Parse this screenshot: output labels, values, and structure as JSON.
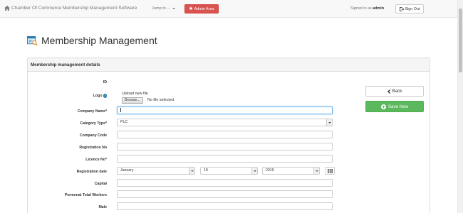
{
  "navbar": {
    "brand": "Chamber Of Commerce Membership Management Software",
    "jump_label": "Jump to ...",
    "admin_label": "Admin Area",
    "signed_prefix": "Signed in as ",
    "signed_user": "admin",
    "signout_label": "Sign Out"
  },
  "page": {
    "title": "Membership Management"
  },
  "panel": {
    "heading": "Membership management details"
  },
  "form": {
    "id_label": "ID",
    "logo_label": "Logo",
    "upload_label": "Upload new file",
    "browse_label": "Browse...",
    "no_file": "No file selected.",
    "company_name_label": "Company Name*",
    "company_name_value": "",
    "category_type_label": "Category Type*",
    "category_type_value": "PLC",
    "company_code_label": "Company Code",
    "registration_no_label": "Registration No",
    "licence_no_label": "Licence No*",
    "registration_date_label": "Registration date",
    "reg_month": "January",
    "reg_day": "18",
    "reg_year": "2019",
    "capital_label": "Capital",
    "permenant_workers_label": "Permenat Total Workers",
    "male_label": "Male"
  },
  "actions": {
    "back_label": "Back",
    "save_label": "Save New"
  },
  "colors": {
    "danger": "#d9534f",
    "success": "#5cb85c",
    "focus": "#66afe9",
    "info": "#2a7ab0"
  }
}
